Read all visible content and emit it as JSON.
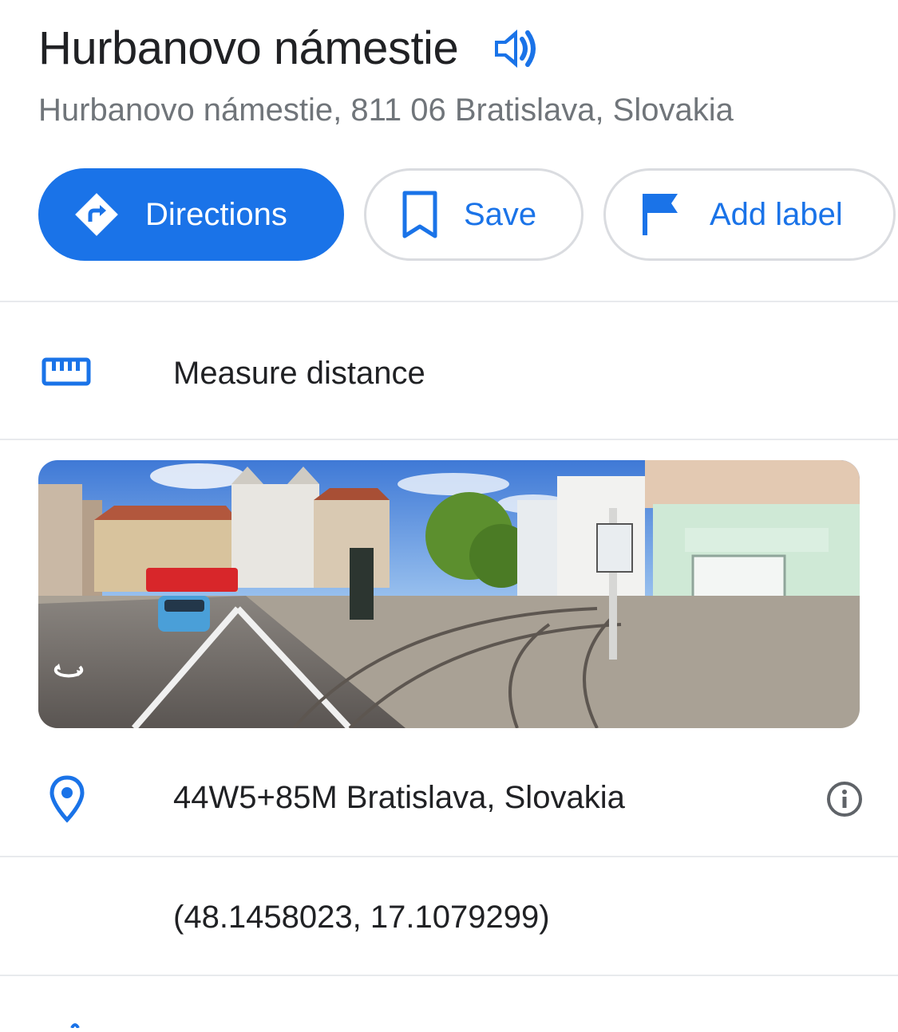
{
  "place": {
    "title": "Hurbanovo námestie",
    "address": "Hurbanovo námestie, 811 06 Bratislava, Slovakia"
  },
  "actions": {
    "directions_label": "Directions",
    "save_label": "Save",
    "add_label_label": "Add label"
  },
  "rows": {
    "measure_distance": "Measure distance",
    "plus_code": "44W5+85M Bratislava, Slovakia",
    "coordinates": "(48.1458023, 17.1079299)"
  },
  "icons": {
    "speaker": "speaker-icon",
    "directions": "directions-icon",
    "save": "bookmark-icon",
    "label": "flag-icon",
    "measure": "ruler-icon",
    "pin": "location-pin-icon",
    "info": "info-icon",
    "rotate": "360-rotate-icon"
  },
  "colors": {
    "accent": "#1a73e8",
    "text": "#202124",
    "secondary": "#70757a",
    "divider": "#e8eaed"
  }
}
